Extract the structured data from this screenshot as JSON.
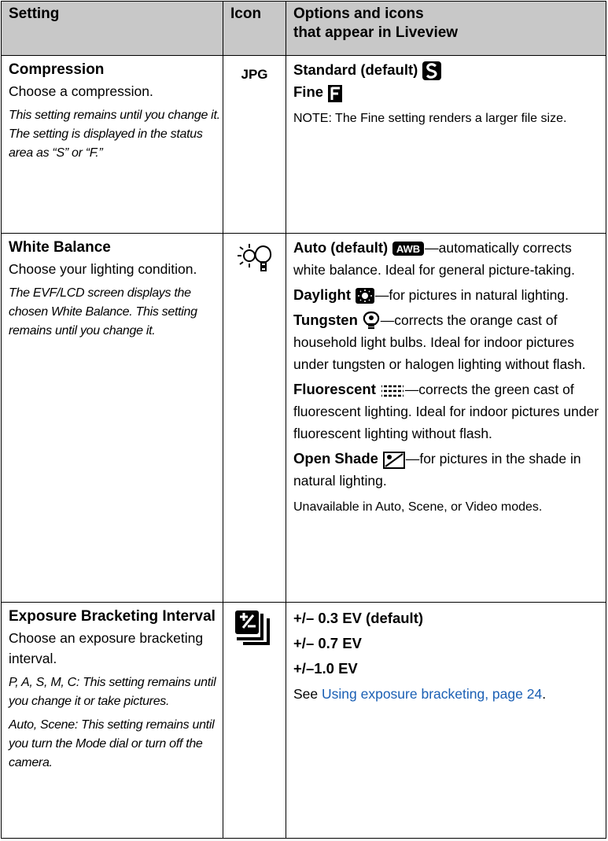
{
  "headers": {
    "setting": "Setting",
    "icon": "Icon",
    "options_line1": "Options and icons",
    "options_line2": "that appear in Liveview"
  },
  "rows": [
    {
      "title": "Compression",
      "desc": "Choose a compression.",
      "note": "This setting remains until you change it. The setting is displayed in the status area as “S” or “F.”",
      "icon_text": "JPG",
      "icon": "jpg-icon",
      "options": [
        {
          "label": "Standard (default)",
          "icon": "standard-s-icon",
          "text": ""
        },
        {
          "label": "Fine",
          "icon": "fine-f-icon",
          "text": ""
        }
      ],
      "footnote": "NOTE:  The Fine setting renders a larger file size."
    },
    {
      "title": "White Balance",
      "desc": "Choose your lighting condition.",
      "note": "The EVF/LCD screen displays the chosen White Balance. This setting remains until you change it.",
      "icon": "white-balance-icon",
      "options": [
        {
          "label": "Auto (default)",
          "icon": "awb-icon",
          "text": "—automatically corrects white balance. Ideal for general picture-taking."
        },
        {
          "label": "Daylight",
          "icon": "daylight-icon",
          "text": "—for pictures in natural lighting."
        },
        {
          "label": "Tungsten",
          "icon": "tungsten-icon",
          "text": "—corrects the orange cast of household light bulbs. Ideal for indoor pictures under tungsten or halogen lighting without flash."
        },
        {
          "label": "Fluorescent",
          "icon": "fluorescent-icon",
          "text": "—corrects the green cast of fluorescent lighting. Ideal for indoor pictures under fluorescent lighting without flash."
        },
        {
          "label": "Open Shade",
          "icon": "open-shade-icon",
          "text": "—for pictures in the shade in natural lighting."
        }
      ],
      "footnote": "Unavailable in Auto, Scene, or Video modes."
    },
    {
      "title": "Exposure Bracketing Interval",
      "desc": "Choose an exposure bracketing interval.",
      "note": "P, A, S, M, C: This setting remains until you change it or take pictures.",
      "note2": "Auto, Scene: This setting remains until you turn the Mode dial or turn off the camera.",
      "icon": "exposure-bracketing-icon",
      "options": [
        {
          "label": "+/– 0.3 EV (default)"
        },
        {
          "label": "+/– 0.7 EV"
        },
        {
          "label": "+/–1.0 EV"
        }
      ],
      "see_prefix": "See ",
      "see_link": "Using exposure bracketing, page 24",
      "see_suffix": ".",
      "link_color": "#1a5fb4"
    }
  ]
}
